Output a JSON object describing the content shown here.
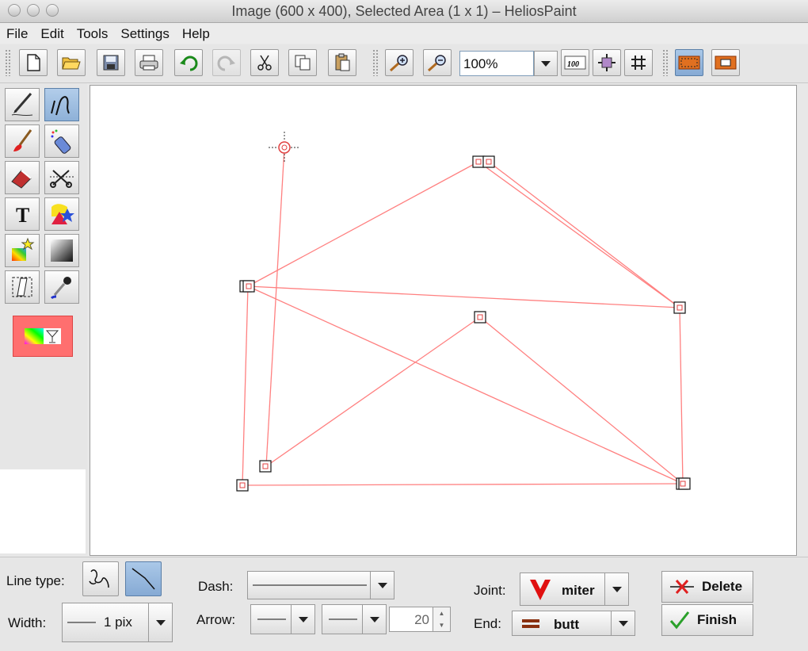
{
  "window": {
    "title": "Image (600 x 400), Selected Area (1 x 1) – HeliosPaint"
  },
  "menu": [
    "File",
    "Edit",
    "Tools",
    "Settings",
    "Help"
  ],
  "toolbar": {
    "zoom_value": "100%"
  },
  "bottom": {
    "line_type_label": "Line type:",
    "width_label": "Width:",
    "width_value": "1 pix",
    "dash_label": "Dash:",
    "arrow_label": "Arrow:",
    "arrow_size": "20",
    "joint_label": "Joint:",
    "joint_value": "miter",
    "end_label": "End:",
    "end_value": "butt",
    "delete_label": "Delete",
    "finish_label": "Finish"
  },
  "colors": {
    "line_color": "#ff8080",
    "swatch_color": "#ff6f6f",
    "accent_selected": "#8eb1d8"
  },
  "icons": {
    "tools": [
      "pencil-icon",
      "curve-icon",
      "brush-icon",
      "spray-icon",
      "eraser-icon",
      "scissors-select-icon",
      "text-icon",
      "shapes-icon",
      "gradient-star-icon",
      "gradient-icon",
      "transform-icon",
      "eyedropper-icon"
    ]
  }
}
